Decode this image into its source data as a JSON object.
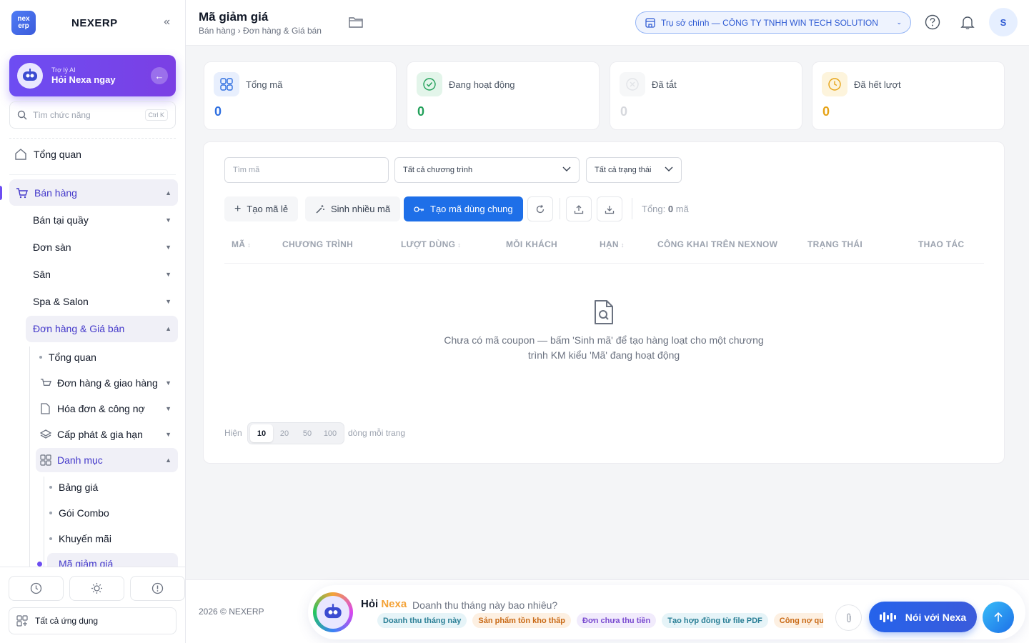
{
  "brand": {
    "logo_text": "nex erp",
    "name": "NEXERP"
  },
  "ai_card": {
    "subtitle": "Trợ lý AI",
    "title": "Hỏi Nexa ngay"
  },
  "side_search": {
    "placeholder": "Tìm chức năng",
    "shortcut": "Ctrl K"
  },
  "nav": {
    "overview": "Tổng quan",
    "sales": "Bán hàng",
    "pos": "Bán tại quầy",
    "marketplace_orders": "Đơn sàn",
    "court": "Sân",
    "spa": "Spa & Salon",
    "orders_pricing": "Đơn hàng & Giá bán",
    "sub_overview": "Tổng quan",
    "orders_delivery": "Đơn hàng & giao hàng",
    "invoices_debt": "Hóa đơn & công nợ",
    "issue_extend": "Cấp phát & gia hạn",
    "catalog": "Danh mục",
    "price_list": "Bảng giá",
    "combo": "Gói Combo",
    "promotion": "Khuyến mãi",
    "coupon": "Mã giảm giá"
  },
  "all_apps": "Tất cả ứng dụng",
  "header": {
    "title": "Mã giảm giá",
    "breadcrumb": "Bán hàng › Đơn hàng & Giá bán",
    "branch": "Trụ sở chính — CÔNG TY TNHH WIN TECH SOLUTION",
    "avatar": "S"
  },
  "stats": [
    {
      "label": "Tổng mã",
      "value": "0",
      "color": "#2f6fe0"
    },
    {
      "label": "Đang hoạt động",
      "value": "0",
      "color": "#22a05a"
    },
    {
      "label": "Đã tắt",
      "value": "0",
      "color": "#d6d8dd"
    },
    {
      "label": "Đã hết lượt",
      "value": "0",
      "color": "#e6a317"
    }
  ],
  "filters": {
    "search_placeholder": "Tìm mã",
    "program": "Tất cả chương trình",
    "status": "Tất cả trạng thái"
  },
  "toolbar": {
    "create_single": "Tạo mã lẻ",
    "generate_many": "Sinh nhiều mã",
    "create_shared": "Tạo mã dùng chung",
    "total_label": "Tổng:",
    "total_value": "0",
    "total_unit": "mã"
  },
  "table": {
    "columns": [
      "MÃ",
      "CHƯƠNG TRÌNH",
      "LƯỢT DÙNG",
      "MỖI KHÁCH",
      "HẠN",
      "CÔNG KHAI TRÊN NEXNOW",
      "TRẠNG THÁI",
      "THAO TÁC"
    ],
    "empty_line1": "Chưa có mã coupon — bấm 'Sinh mã' để tạo hàng loạt cho một chương",
    "empty_line2": "trình KM kiểu 'Mã' đang hoạt động"
  },
  "pagination": {
    "show_label": "Hiện",
    "sizes": [
      "10",
      "20",
      "50",
      "100"
    ],
    "selected": "10",
    "per_page_label": "dòng mỗi trang"
  },
  "footer": {
    "copyright": "2026 © NEXERP",
    "ask_prefix": "Hỏi",
    "ask_brand": "Nexa",
    "ask_question": "Doanh thu tháng này bao nhiêu?",
    "chips": [
      {
        "label": "Doanh thu tháng này",
        "bg": "#e6f4f8",
        "fg": "#2a7f96"
      },
      {
        "label": "Sản phẩm tồn kho thấp",
        "bg": "#fdf0e2",
        "fg": "#c96a16"
      },
      {
        "label": "Đơn chưa thu tiền",
        "bg": "#f1ebfc",
        "fg": "#7a4bd0"
      },
      {
        "label": "Tạo hợp đồng từ file PDF",
        "bg": "#e6f4f8",
        "fg": "#2a7f96"
      },
      {
        "label": "Công nợ quá hạn",
        "bg": "#fdf0e2",
        "fg": "#c96a16"
      }
    ],
    "voice_btn": "Nói với Nexa"
  }
}
